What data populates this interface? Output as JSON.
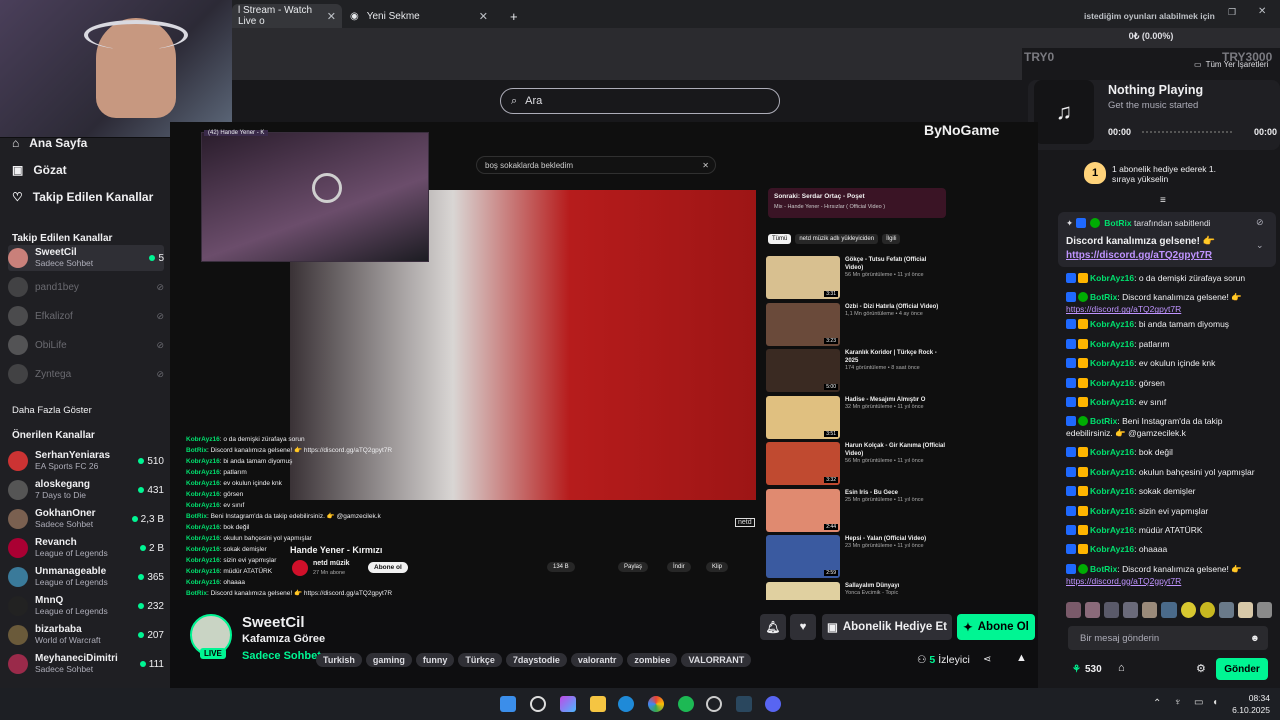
{
  "browser": {
    "tabs": [
      {
        "label": "l Stream - Watch Live o"
      },
      {
        "label": "Yeni Sekme"
      }
    ],
    "new_tab": "+",
    "bookmarks": "Tüm Yer İşaretleri",
    "window_title": "istediğim oyunları alabilmek için"
  },
  "donation": {
    "progress_text": "0₺ (0.00%)",
    "start": "TRY0",
    "goal": "TRY3000",
    "progress_fraction": 0.0
  },
  "music": {
    "title": "Nothing Playing",
    "subtitle": "Get the music started",
    "time_start": "00:00",
    "time_end": "00:00"
  },
  "search": {
    "placeholder": "Ara"
  },
  "sidebar": {
    "nav": [
      {
        "label": "Ana Sayfa"
      },
      {
        "label": "Gözat"
      },
      {
        "label": "Takip Edilen Kanallar"
      }
    ],
    "followed_title": "Takip Edilen Kanallar",
    "followed": [
      {
        "name": "SweetCil",
        "game": "Sadece Sohbet",
        "viewers": "5"
      },
      {
        "name": "pand1bey"
      },
      {
        "name": "Efkalizof"
      },
      {
        "name": "ObiLife"
      },
      {
        "name": "Zyntega"
      }
    ],
    "show_more": "Daha Fazla Göster",
    "recommended_title": "Önerilen Kanallar",
    "recommended": [
      {
        "name": "SerhanYeniaras",
        "game": "EA Sports FC 26",
        "viewers": "510"
      },
      {
        "name": "aloskegang",
        "game": "7 Days to Die",
        "viewers": "431"
      },
      {
        "name": "GokhanOner",
        "game": "Sadece Sohbet",
        "viewers": "2,3 B"
      },
      {
        "name": "Revanch",
        "game": "League of Legends",
        "viewers": "2 B"
      },
      {
        "name": "Unmanageable",
        "game": "League of Legends",
        "viewers": "365"
      },
      {
        "name": "MnnQ",
        "game": "League of Legends",
        "viewers": "232"
      },
      {
        "name": "bizarbaba",
        "game": "World of Warcraft",
        "viewers": "207"
      },
      {
        "name": "MeyhaneciDimitri",
        "game": "Sadece Sohbet",
        "viewers": "111"
      }
    ]
  },
  "video": {
    "pip_label": "(42) Hande Yener - K",
    "yt_search": "boş sokaklarda bekledim",
    "watermark": "ByNoGame",
    "song_title": "Hande Yener - Kırmızı",
    "yt_channel": "netd müzik",
    "yt_subs": "27 Mn abone",
    "yt_subscribe": "Abone ol",
    "yt_likes": "134 B",
    "yt_share": "Paylaş",
    "yt_download": "İndir",
    "yt_clip": "Klip",
    "netd": "netd",
    "next_label": "Sonraki: Serdar Ortaç - Poşet",
    "next_sub": "Mix - Hande Yener - Hırsızlar ( Official Video )",
    "chips": [
      "Tümü",
      "netd müzik adlı yükleyiciden",
      "İlgili"
    ],
    "suggestions": [
      {
        "title": "Gökçe - Tutsu Fefatı (Official Video)",
        "meta": "56 Mn görüntüleme • 11 yıl önce",
        "dur": "3:31"
      },
      {
        "title": "Ozbi - Dizi Hatırla (Official Video)",
        "meta": "1,1 Mn görüntüleme • 4 ay önce",
        "dur": "3:23"
      },
      {
        "title": "Karanlık Koridor | Türkçe Rock - 2025",
        "meta": "174 görüntüleme • 8 saat önce",
        "dur": "5:00"
      },
      {
        "title": "Hadise - Mesajımı Almıştır O",
        "meta": "32 Mn görüntüleme • 11 yıl önce",
        "dur": "3:51"
      },
      {
        "title": "Harun Kolçak - Gir Kanıma (Official Video)",
        "meta": "56 Mn görüntüleme • 11 yıl önce",
        "dur": "3:32"
      },
      {
        "title": "Esin Iris - Bu Gece",
        "meta": "25 Mn görüntüleme • 11 yıl önce",
        "dur": "2:44"
      },
      {
        "title": "Hepsi - Yalan (Official Video)",
        "meta": "23 Mn görüntüleme • 11 yıl önce",
        "dur": "2:59"
      },
      {
        "title": "Sallayalım Dünyayı",
        "meta": "Yonca Evcimik - Topic",
        "dur": ""
      }
    ],
    "overlay_chat": [
      {
        "user": "KobrAyz16",
        "msg": ": o da demişki zürafaya sorun"
      },
      {
        "user": "BotRix",
        "msg": ": Discord kanalımıza gelsene! 👉 https://discord.gg/aTQ2gpyt7R"
      },
      {
        "user": "KobrAyz16",
        "msg": ": bi anda tamam diyomuş"
      },
      {
        "user": "KobrAyz16",
        "msg": ": patlarım"
      },
      {
        "user": "KobrAyz16",
        "msg": ": ev okulun içinde knk"
      },
      {
        "user": "KobrAyz16",
        "msg": ": görsen"
      },
      {
        "user": "KobrAyz16",
        "msg": ": ev sınıf"
      },
      {
        "user": "BotRix",
        "msg": ": Beni Instagram'da da takip edebilirsiniz. 👉 @gamzecilek.k"
      },
      {
        "user": "KobrAyz16",
        "msg": ": bok değil"
      },
      {
        "user": "KobrAyz16",
        "msg": ": okulun bahçesini yol yapmışlar"
      },
      {
        "user": "KobrAyz16",
        "msg": ": sokak demişler"
      },
      {
        "user": "KobrAyz16",
        "msg": ": sizin evi yapmışlar"
      },
      {
        "user": "KobrAyz16",
        "msg": ": müdür ATATÜRK"
      },
      {
        "user": "KobrAyz16",
        "msg": ": ohaaaa"
      },
      {
        "user": "BotRix",
        "msg": ": Discord kanalımıza gelsene! 👉 https://discord.gg/aTQ2gpyt7R"
      }
    ]
  },
  "channel": {
    "name": "SweetCil",
    "title": "Kafamıza Göree",
    "category": "Sadece Sohbet",
    "live": "LIVE",
    "tags": [
      "Turkish",
      "gaming",
      "funny",
      "Türkçe",
      "7daystodie",
      "valorantr",
      "zombiee",
      "VALORRANT"
    ],
    "gift_button": "Abonelik Hediye Et",
    "subscribe_button": "Abone Ol",
    "viewers": "5",
    "viewers_label": "İzleyici"
  },
  "chat": {
    "gift_banner": "1 abonelik hediye ederek 1. sıraya yükselin",
    "gift_rank": "1",
    "pinned_by": "BotRix",
    "pinned_suffix": "tarafından sabitlendi",
    "pinned_msg": "Discord kanalımıza gelsene! 👉",
    "pinned_link": "https://discord.gg/aTQ2gpyt7R",
    "messages": [
      {
        "user": "KobrAyz16",
        "msg": ": o da demişki zürafaya sorun",
        "badge": "orange"
      },
      {
        "user": "BotRix",
        "msg": ": Discord kanalımıza gelsene! 👉",
        "link": "https://discord.gg/aTQ2gpyt7R",
        "badge": "green"
      },
      {
        "user": "KobrAyz16",
        "msg": ": bi anda tamam diyomuş",
        "badge": "orange"
      },
      {
        "user": "KobrAyz16",
        "msg": ": patlarım",
        "badge": "orange"
      },
      {
        "user": "KobrAyz16",
        "msg": ": ev okulun içinde knk",
        "badge": "orange"
      },
      {
        "user": "KobrAyz16",
        "msg": ": görsen",
        "badge": "orange"
      },
      {
        "user": "KobrAyz16",
        "msg": ": ev sınıf",
        "badge": "orange"
      },
      {
        "user": "BotRix",
        "msg": ": Beni Instagram'da da takip edebilirsiniz. 👉 @gamzecilek.k",
        "badge": "green"
      },
      {
        "user": "KobrAyz16",
        "msg": ": bok değil",
        "badge": "orange"
      },
      {
        "user": "KobrAyz16",
        "msg": ": okulun bahçesini yol yapmışlar",
        "badge": "orange"
      },
      {
        "user": "KobrAyz16",
        "msg": ": sokak demişler",
        "badge": "orange"
      },
      {
        "user": "KobrAyz16",
        "msg": ": sizin evi yapmışlar",
        "badge": "orange"
      },
      {
        "user": "KobrAyz16",
        "msg": ": müdür ATATÜRK",
        "badge": "orange"
      },
      {
        "user": "KobrAyz16",
        "msg": ": ohaaaa",
        "badge": "orange"
      },
      {
        "user": "BotRix",
        "msg": ": Discord kanalımıza gelsene! 👉",
        "link": "https://discord.gg/aTQ2gpyt7R",
        "badge": "green"
      }
    ],
    "input_placeholder": "Bir mesaj gönderin",
    "points": "530",
    "send_button": "Gönder"
  },
  "taskbar": {
    "time": "08:34",
    "date": "6.10.2025"
  },
  "colors": {
    "accent": "#00f593",
    "link": "#bf94ff",
    "live": "#eb0400"
  }
}
